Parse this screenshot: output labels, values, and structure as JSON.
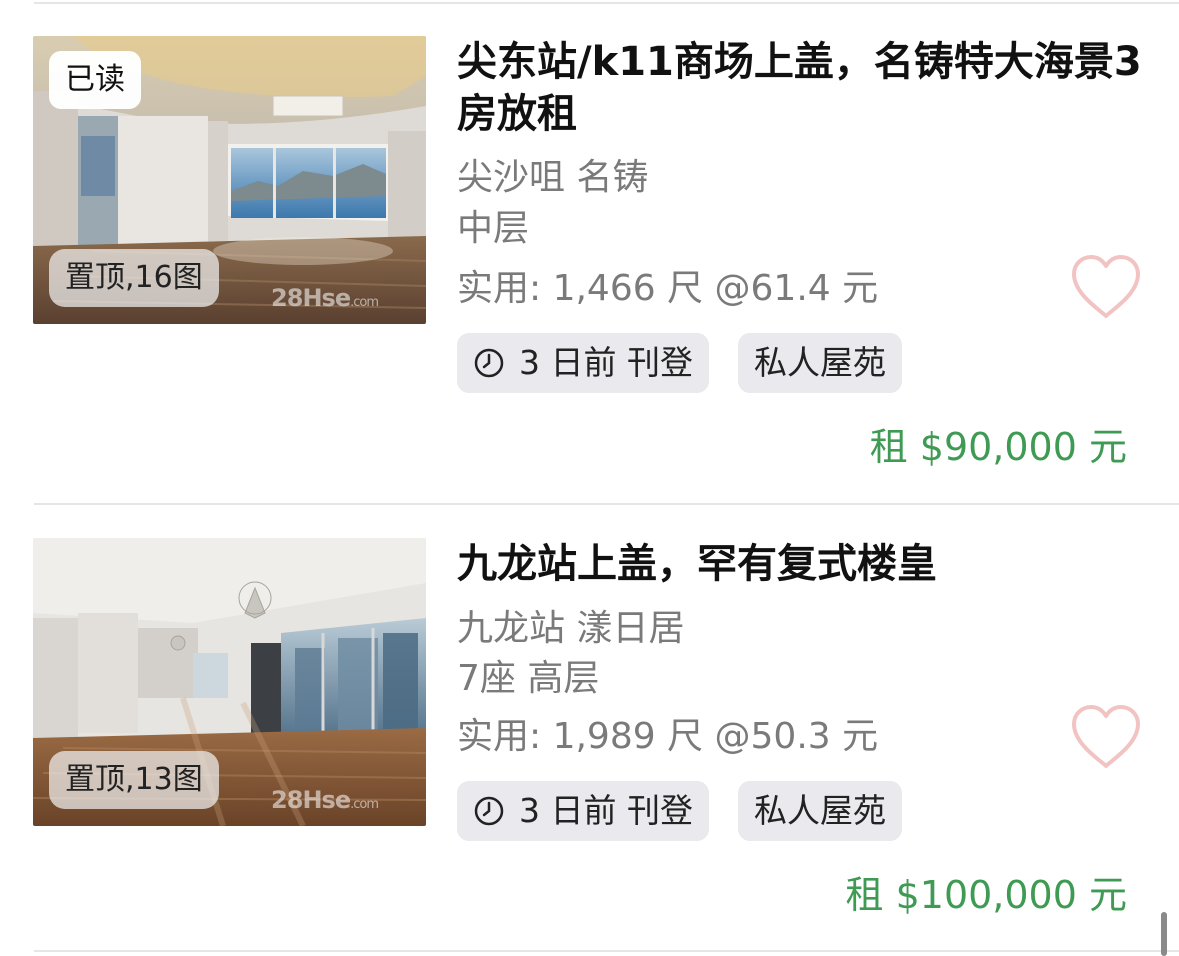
{
  "listings": [
    {
      "read_badge": "已读",
      "photo_badge": "置顶,16图",
      "watermark": "28Hse",
      "watermark_suffix": ".com",
      "title": "尖东站/k11商场上盖，名铸特大海景3房放租",
      "district_estate": "尖沙咀 名铸",
      "floor": "中层",
      "area_line": "实用: 1,466 尺  @61.4 元",
      "posted_tag": "3 日前 刊登",
      "type_tag": "私人屋苑",
      "price": "租 $90,000 元",
      "favorite_icon": "heart-outline-icon"
    },
    {
      "read_badge": "",
      "photo_badge": "置顶,13图",
      "watermark": "28Hse",
      "watermark_suffix": ".com",
      "title": "九龙站上盖，罕有复式楼皇",
      "district_estate": "九龙站 漾日居",
      "floor": "7座 高层",
      "area_line": "实用: 1,989 尺  @50.3 元",
      "posted_tag": "3 日前 刊登",
      "type_tag": "私人屋苑",
      "price": "租 $100,000 元",
      "favorite_icon": "heart-outline-icon"
    }
  ],
  "colors": {
    "price": "#3f9a54",
    "heart": "#f2c3c3",
    "tag_bg": "#e9e9ee",
    "secondary_text": "#7a7a7a"
  }
}
